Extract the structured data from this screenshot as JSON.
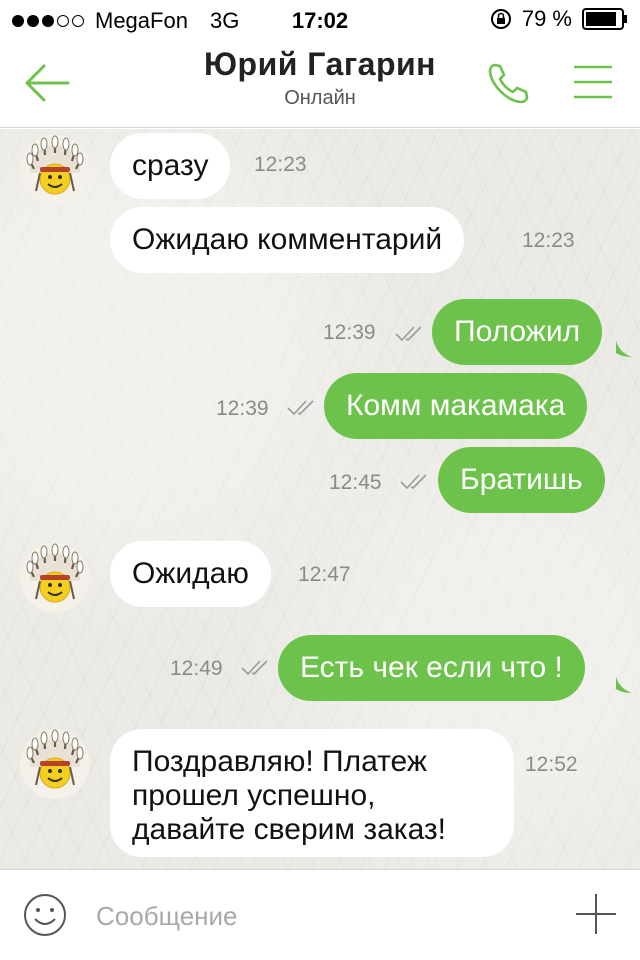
{
  "status_bar": {
    "carrier": "MegaFon",
    "network": "3G",
    "time": "17:02",
    "battery": "79 %"
  },
  "header": {
    "name": "Юрий Гагарин",
    "status": "Онлайн"
  },
  "colors": {
    "accent": "#6cc24a",
    "outgoing_bubble": "#6cc24a",
    "incoming_bubble": "#ffffff"
  },
  "messages": [
    {
      "direction": "in",
      "text": "сразу",
      "time": "12:23"
    },
    {
      "direction": "in",
      "text": "Ожидаю комментарий",
      "time": "12:23"
    },
    {
      "direction": "out",
      "text": "Положил",
      "time": "12:39"
    },
    {
      "direction": "out",
      "text": "Комм макамака",
      "time": "12:39"
    },
    {
      "direction": "out",
      "text": "Братишь",
      "time": "12:45"
    },
    {
      "direction": "in",
      "text": "Ожидаю",
      "time": "12:47"
    },
    {
      "direction": "out",
      "text": "Есть чек если что !",
      "time": "12:49"
    },
    {
      "direction": "in",
      "lines": [
        "Поздравляю! Платеж",
        "прошел успешно,",
        "давайте сверим заказ!"
      ],
      "time": "12:52"
    }
  ],
  "composer": {
    "placeholder": "Сообщение"
  },
  "icons": {
    "back": "arrow-left-icon",
    "call": "phone-icon",
    "menu": "hamburger-icon",
    "emoji": "smiley-icon",
    "attach": "plus-icon",
    "read": "double-check-icon",
    "avatar": "chief-smiley-avatar"
  }
}
